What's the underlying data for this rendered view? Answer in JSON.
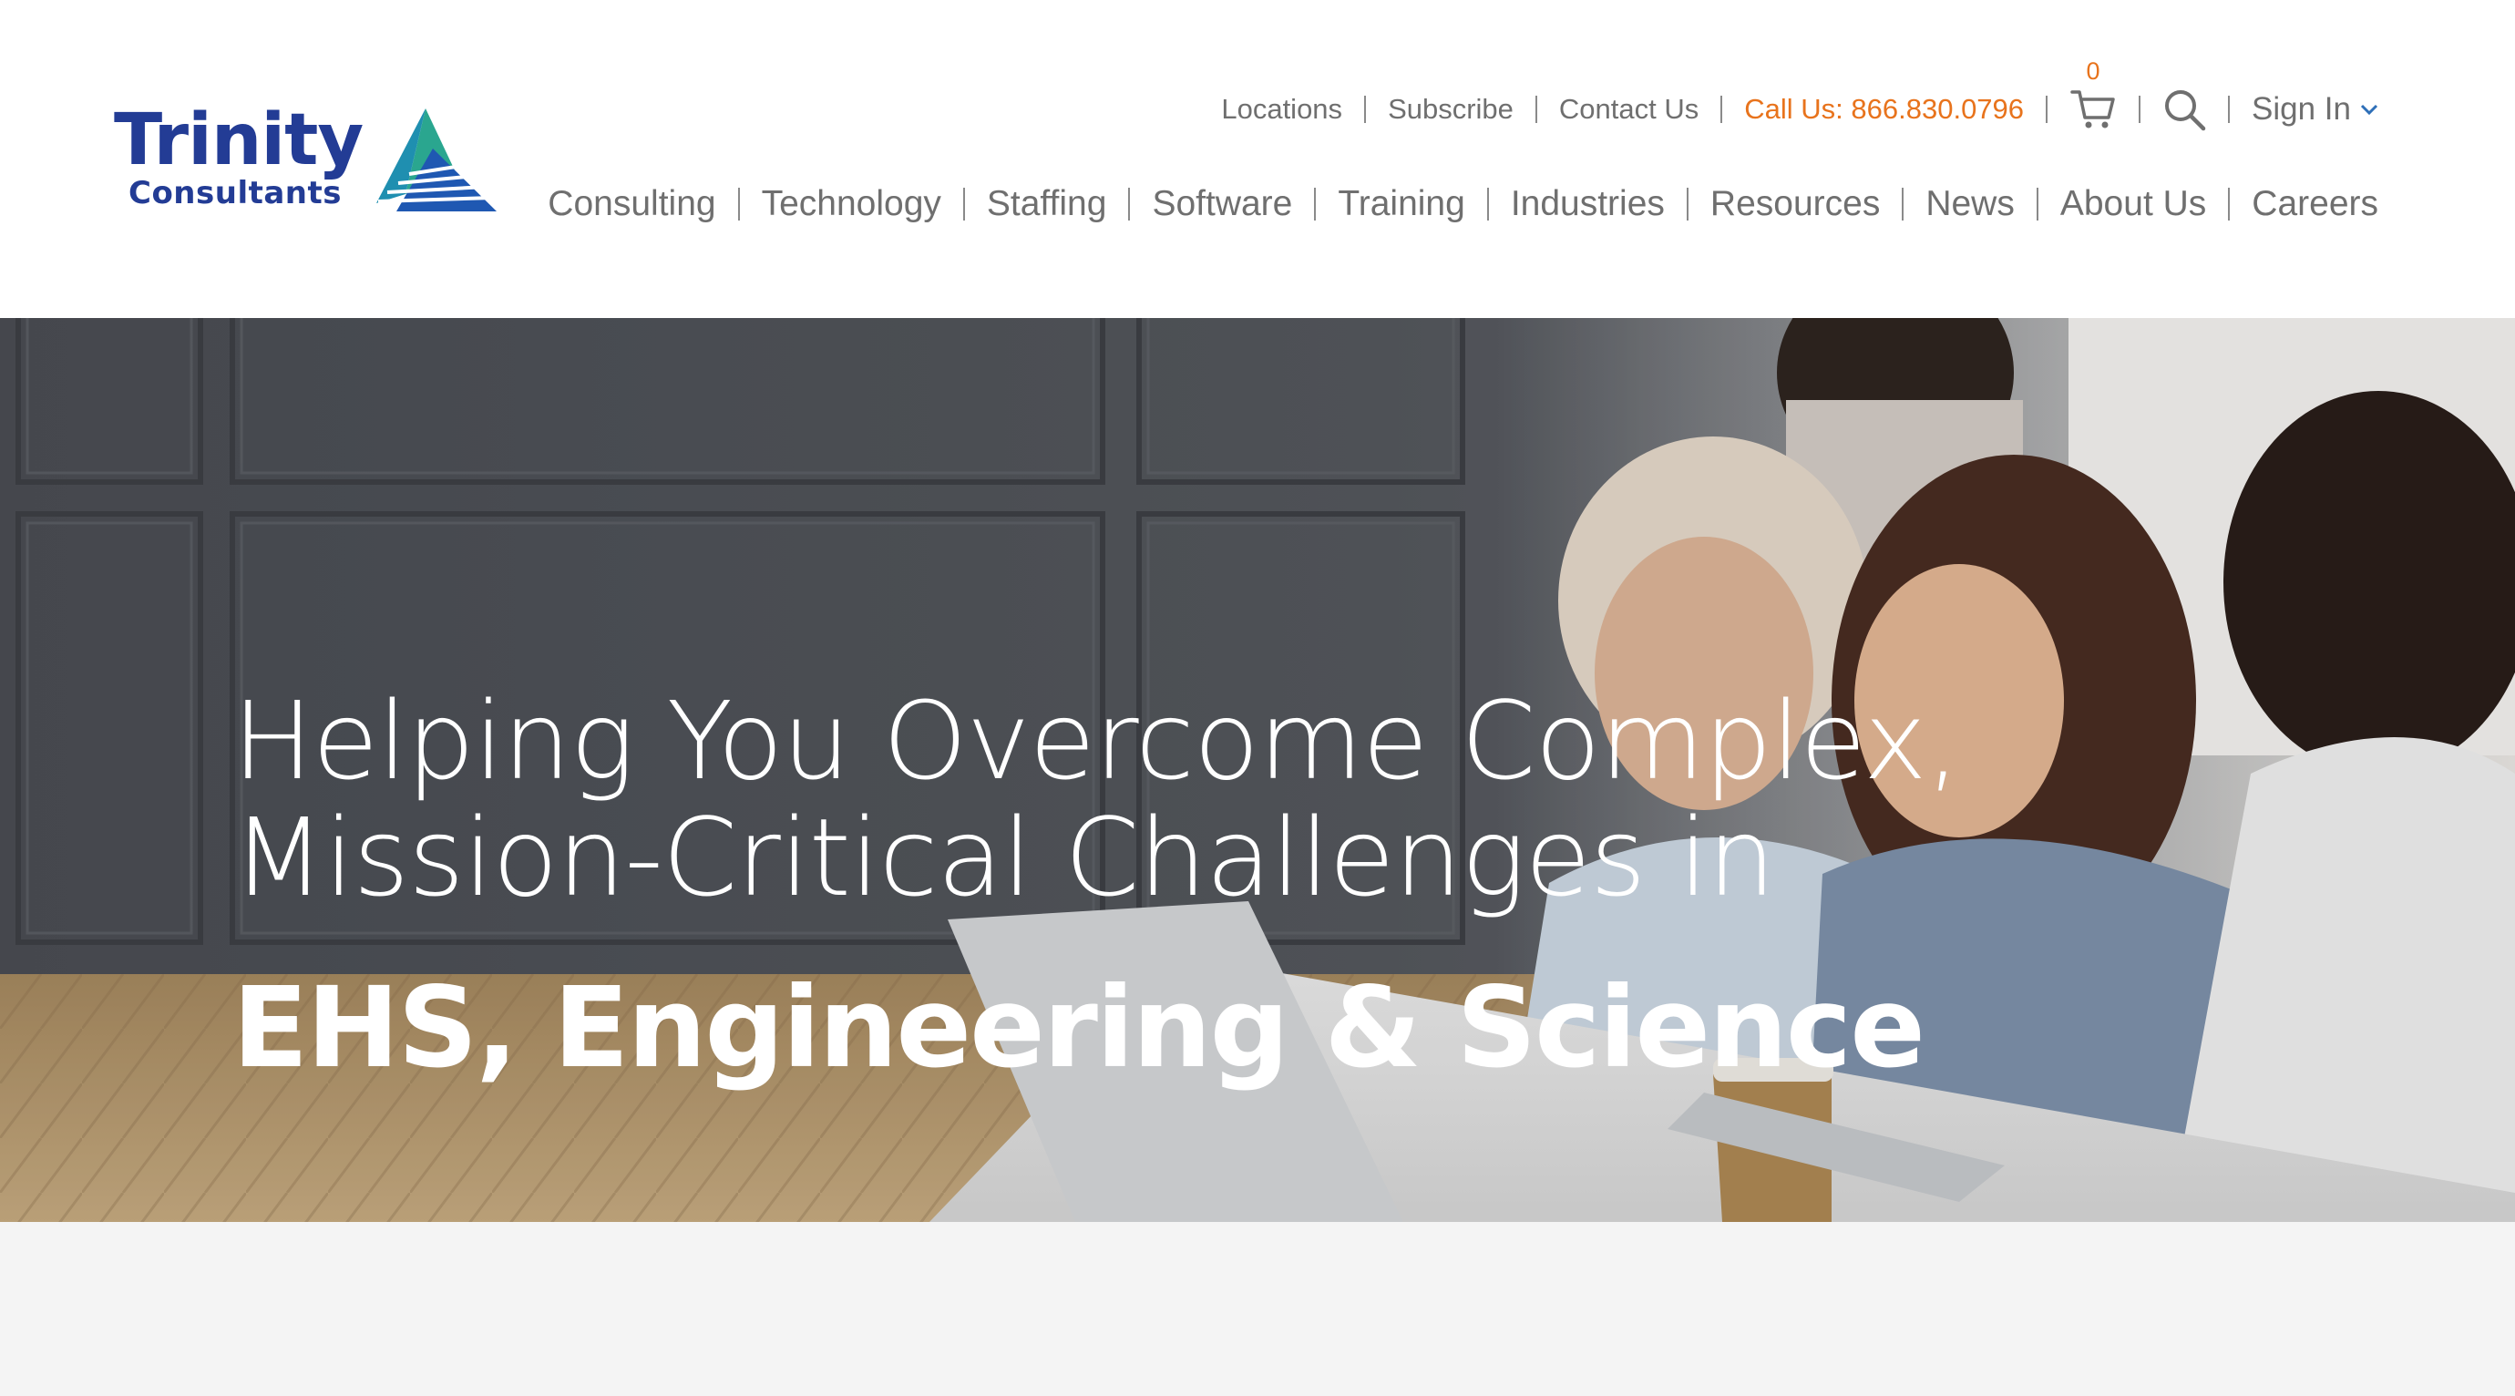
{
  "logo": {
    "word": "Trinity",
    "sub": "Consultants"
  },
  "utility_nav": {
    "locations": "Locations",
    "subscribe": "Subscribe",
    "contact": "Contact Us",
    "call": "Call Us: 866.830.0796",
    "cart_count": "0",
    "sign_in": "Sign In"
  },
  "main_nav": [
    {
      "label": "Consulting"
    },
    {
      "label": "Technology"
    },
    {
      "label": "Staffing"
    },
    {
      "label": "Software"
    },
    {
      "label": "Training"
    },
    {
      "label": "Industries"
    },
    {
      "label": "Resources"
    },
    {
      "label": "News"
    },
    {
      "label": "About Us"
    },
    {
      "label": "Careers"
    }
  ],
  "hero": {
    "line1": "Helping You Overcome Complex,",
    "line2": "Mission-Critical Challenges in",
    "highlight": "EHS, Engineering & Science"
  },
  "colors": {
    "brand_blue": "#233c95",
    "accent_orange": "#e8731c",
    "nav_gray": "#6f6f6f",
    "band_gray": "#f4f4f4"
  },
  "icons": [
    "cart-icon",
    "search-icon",
    "chevron-down-icon",
    "logo-triangle-icon"
  ]
}
